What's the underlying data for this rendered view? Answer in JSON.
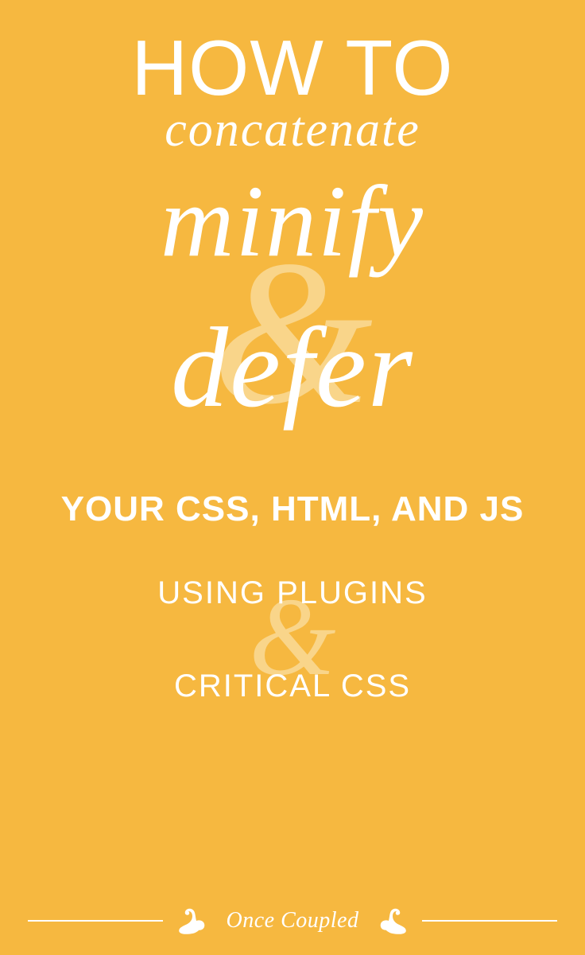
{
  "title": {
    "line1": "HOW TO",
    "line2": "concatenate",
    "line3": "minify",
    "line4": "defer"
  },
  "subtitle": "YOUR CSS, HTML, AND JS",
  "methods": {
    "line1": "USING PLUGINS",
    "line2": "CRITICAL CSS"
  },
  "ampersand": "&",
  "brand": "Once Coupled",
  "colors": {
    "background": "#f6b840",
    "text": "#ffffff",
    "ampersand": "#f9d58a"
  }
}
